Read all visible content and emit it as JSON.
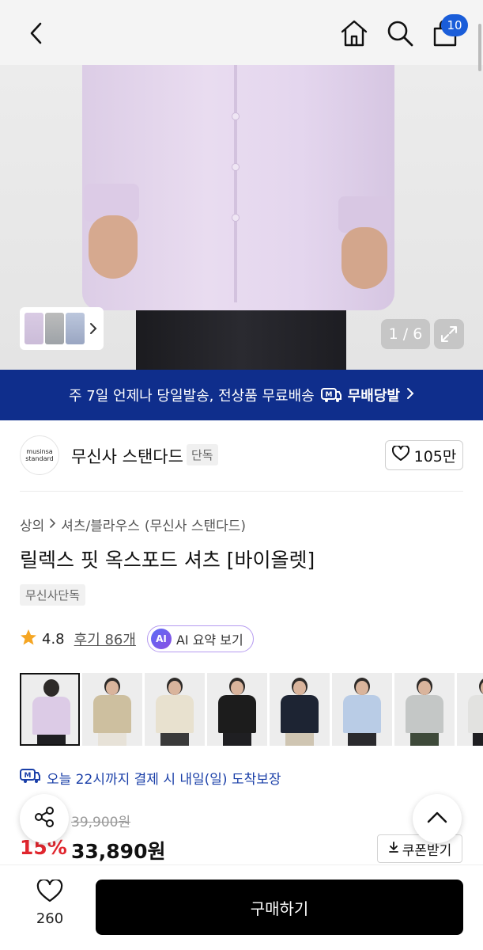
{
  "header": {
    "cart_count": "10",
    "icons": [
      "back-icon",
      "home-icon",
      "search-icon",
      "cart-icon"
    ]
  },
  "gallery": {
    "counter": "1 / 6",
    "icons": [
      "expand-icon",
      "chevron-right-icon"
    ]
  },
  "shipping_banner": {
    "text": "주 7일 언제나 당일발송, 전상품 무료배송",
    "service": "무배당발",
    "accent": "#0f2e8c"
  },
  "brand": {
    "logo_line1": "musinsa",
    "logo_line2": "standard",
    "name": "무신사 스탠다드",
    "tag": "단독",
    "likes": "105만"
  },
  "product": {
    "breadcrumb": {
      "level1": "상의",
      "level2": "셔츠/블라우스",
      "brand": "(무신사 스탠다드)"
    },
    "title": "릴렉스 핏 옥스포드 셔츠 [바이올렛]",
    "exclusive_tag": "무신사단독",
    "rating": "4.8",
    "reviews": "후기 86개",
    "ai_badge": "AI",
    "ai_summary": "AI 요약 보기",
    "delivery": "오늘 22시까지 결제 시 내일(일) 도착보장",
    "original_price": "39,900원",
    "discount": "15%",
    "price": "33,890원",
    "coupon": "쿠폰받기"
  },
  "colors": {
    "discount_red": "#e0262e",
    "delivery_blue": "#1a3fa8",
    "ai_border": "#b59af0"
  },
  "bottom": {
    "wish_count": "260",
    "buy_label": "구매하기"
  }
}
